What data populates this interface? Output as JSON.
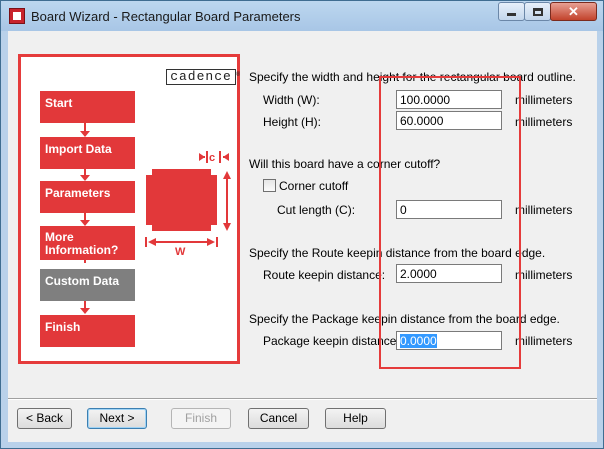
{
  "window": {
    "title": "Board Wizard - Rectangular Board Parameters",
    "close_glyph": "✕"
  },
  "sidebar": {
    "logo": "cadence",
    "steps": [
      {
        "label": "Start",
        "active": false
      },
      {
        "label": "Import Data",
        "active": false
      },
      {
        "label": "Parameters",
        "active": false
      },
      {
        "label": "More Information?",
        "active": false
      },
      {
        "label": "Custom Data",
        "active": true
      },
      {
        "label": "Finish",
        "active": false
      }
    ],
    "diagram": {
      "c_label": "c",
      "w_label": "W"
    }
  },
  "form": {
    "outline_prompt": "Specify the width and height for the rectangular board outline.",
    "width_label": "Width (W):",
    "width_value": "100.0000",
    "height_label": "Height (H):",
    "height_value": "60.0000",
    "cutoff_prompt": "Will this board have a corner cutoff?",
    "corner_cutoff_label": "Corner cutoff",
    "corner_cutoff_checked": false,
    "cut_length_label": "Cut length (C):",
    "cut_length_value": "0",
    "route_prompt": "Specify the Route keepin distance from the board edge.",
    "route_label": "Route keepin distance:",
    "route_value": "2.0000",
    "package_prompt": "Specify the Package keepin distance from the board edge.",
    "package_label": "Package keepin distance:",
    "package_value": "0.0000",
    "unit": "millimeters"
  },
  "buttons": {
    "back": "< Back",
    "next": "Next >",
    "finish": "Finish",
    "cancel": "Cancel",
    "help": "Help"
  },
  "colors": {
    "accent_red": "#e2383a",
    "active_step": "#7f7f7f",
    "selection": "#3399ff"
  }
}
